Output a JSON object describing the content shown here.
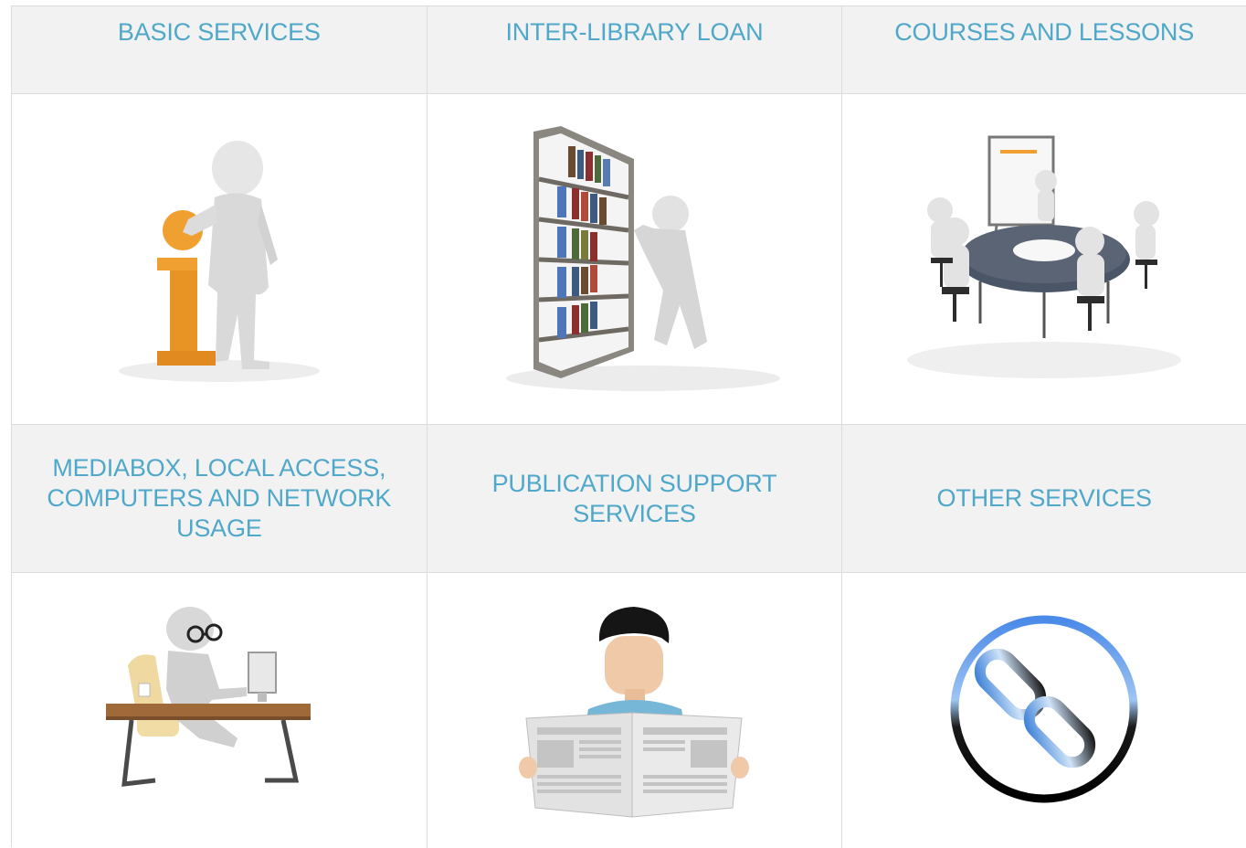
{
  "services": [
    {
      "title": "BASIC SERVICES",
      "icon": "information-person-icon"
    },
    {
      "title": "INTER-LIBRARY LOAN",
      "icon": "bookshelf-person-icon"
    },
    {
      "title": "COURSES AND LESSONS",
      "icon": "meeting-table-icon"
    },
    {
      "title": "MEDIABOX, LOCAL ACCESS, COMPUTERS AND NETWORK USAGE",
      "icon": "person-at-computer-icon"
    },
    {
      "title": "PUBLICATION SUPPORT SERVICES",
      "icon": "person-reading-newspaper-icon"
    },
    {
      "title": "OTHER SERVICES",
      "icon": "chain-link-icon"
    }
  ],
  "colors": {
    "title_text": "#4fa8c9",
    "header_bg": "#f2f2f2",
    "border": "#dcdcdc",
    "info_orange": "#f0a030",
    "link_ring_blue": "#3a7fd8"
  }
}
